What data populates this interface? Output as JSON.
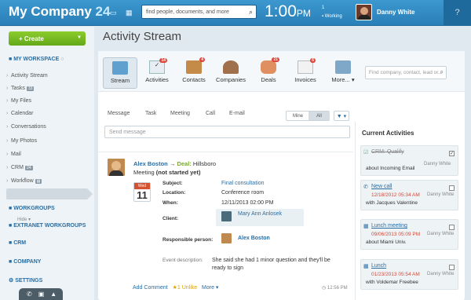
{
  "header": {
    "logo_main": "My Company",
    "logo_num": "24",
    "icons": [
      "chat-icon",
      "calendar-icon"
    ],
    "search_placeholder": "find people, documents, and more",
    "time": "1:00",
    "time_suffix": "PM",
    "indicator_top": "1",
    "status": "Working",
    "user_name": "Danny White",
    "help": "?"
  },
  "sidebar": {
    "create_label": "Create",
    "sections": {
      "workspace": "MY WORKSPACE",
      "workgroups": "WORKGROUPS",
      "extranet": "EXTRANET WORKGROUPS",
      "crm": "CRM",
      "company": "COMPANY",
      "settings": "SETTINGS"
    },
    "items": [
      {
        "label": "Activity Stream"
      },
      {
        "label": "Tasks",
        "badge": "33"
      },
      {
        "label": "My Files"
      },
      {
        "label": "Calendar"
      },
      {
        "label": "Conversations"
      },
      {
        "label": "My Photos"
      },
      {
        "label": "Mail"
      },
      {
        "label": "CRM",
        "badge": "24"
      },
      {
        "label": "Workflow"
      }
    ],
    "hide_label": "Hide"
  },
  "page_title": "Activity Stream",
  "tabs": [
    {
      "label": "Stream",
      "badge": ""
    },
    {
      "label": "Activities",
      "badge": "14"
    },
    {
      "label": "Contacts",
      "badge": "4"
    },
    {
      "label": "Companies",
      "badge": ""
    },
    {
      "label": "Deals",
      "badge": "21"
    },
    {
      "label": "Invoices",
      "badge": "6"
    },
    {
      "label": "More...",
      "badge": ""
    }
  ],
  "crm_search_placeholder": "Find company, contact, lead or...",
  "filter_tabs": [
    "Message",
    "Task",
    "Meeting",
    "Call",
    "E-mail"
  ],
  "mine_label": "Mine",
  "all_label": "All",
  "send_placeholder": "Send message",
  "post": {
    "author": "Alex Boston",
    "arrow": "→",
    "deal_prefix": "Deal:",
    "deal_name": "Hillsboro",
    "meeting": "Meeting",
    "meeting_status": "(not started yet)",
    "cal_day": "Wed",
    "cal_num": "11",
    "subject_label": "Subject:",
    "subject": "Final consultation",
    "location_label": "Location:",
    "location": "Conference room",
    "when_label": "When:",
    "when": "12/11/2013 02:00 PM",
    "client_label": "Client:",
    "client": "Mary Ann Anlosek",
    "responsible_label": "Responsible person:",
    "responsible": "Alex Boston",
    "desc_label": "Event description:",
    "desc": "She said she had 1 minor question and they'll be ready to sign",
    "add_comment": "Add Comment",
    "like": "★1 Unlike",
    "more": "More ▾",
    "time": "◷ 12:56 PM"
  },
  "current": {
    "title": "Current Activities",
    "cards": [
      {
        "title": "CRM: Qualify",
        "done": true,
        "date": "",
        "sub": "about Incoming Email",
        "owner": "Danny White"
      },
      {
        "title": "New call",
        "done": false,
        "date": "12/18/2012 05:34 AM",
        "sub": "with Jacques Valentine",
        "owner": "Danny White"
      },
      {
        "title": "Lunch meeting",
        "done": false,
        "date": "09/06/2013 05:09 PM",
        "sub": "about Miami Univ.",
        "owner": "Danny White"
      },
      {
        "title": "Lunch",
        "done": false,
        "date": "01/23/2013 05:54 AM",
        "sub": "with Voldemar Freebee",
        "owner": "Danny White"
      }
    ]
  },
  "colors": {
    "brand": "#2f89c2",
    "create": "#74b71f",
    "badge": "#e0453a",
    "date": "#d34a3a"
  }
}
